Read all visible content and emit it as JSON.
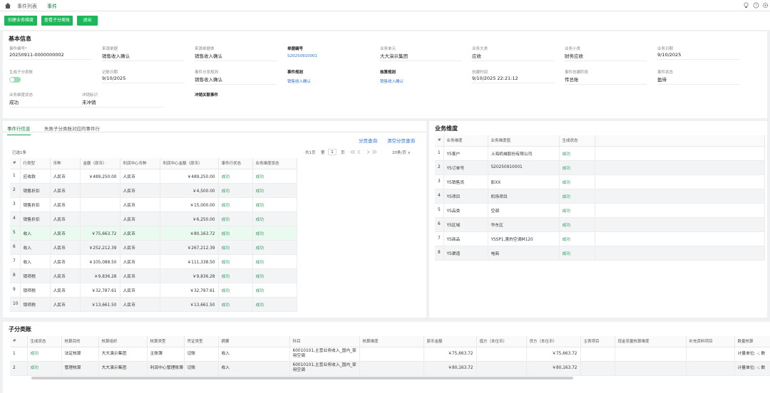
{
  "nav": {
    "tabs": [
      "事件列表",
      "事件"
    ],
    "active": 1
  },
  "toolbar": {
    "buttons": [
      "创建业务维度",
      "查看子分类账",
      "退出"
    ]
  },
  "basic": {
    "title": "基本信息",
    "fields": [
      {
        "label": "事件编号*",
        "value": "20250911-0000000002"
      },
      {
        "label": "来源单据",
        "value": "销售收入确认"
      },
      {
        "label": "来源单据体",
        "value": "销售收入确认"
      },
      {
        "label": "单据编号",
        "value": "S20250910001"
      },
      {
        "label": "业务单元",
        "value": "大大演示集团"
      },
      {
        "label": "业务大类",
        "value": "应收"
      },
      {
        "label": "业务小类",
        "value": "财务应收"
      },
      {
        "label": "业务日期",
        "value": "9/10/2025"
      },
      {
        "label": "生成子分类账",
        "value": ""
      },
      {
        "label": "记账日期",
        "value": "9/10/2025"
      },
      {
        "label": "事件分发规则",
        "value": "销售收入确认"
      },
      {
        "label": "事件规则",
        "value": "销售收入确认"
      },
      {
        "label": "核算规则",
        "value": "销售收入确认"
      },
      {
        "label": "创建时间",
        "value": "9/10/2025 22:21:12"
      },
      {
        "label": "事件创建阶段",
        "value": "传总账"
      },
      {
        "label": "事件状态",
        "value": "盈待"
      },
      {
        "label": "业务维度状态",
        "value": "成功"
      },
      {
        "label": "冲销标识",
        "value": "未冲销"
      },
      {
        "label": "冲销关联事件",
        "value": ""
      }
    ]
  },
  "lines": {
    "tabs": [
      "事件行信息",
      "失败子分类账对应的事件行"
    ],
    "actions": [
      "分页查询",
      "清空分页查询"
    ],
    "selected": "已选1条",
    "pager": {
      "total": "共1页",
      "page_prefix": "第",
      "page": "1",
      "page_suffix": "页",
      "size": "20条/页 ∨"
    },
    "headers": [
      "#",
      "行类型",
      "币种",
      "金额（原币）",
      "利润中心币种",
      "利润中心金额（原币）",
      "事件行状态",
      "业务维度状态"
    ],
    "rows": [
      [
        "1",
        "应收款",
        "人民币",
        "￥489,250.00",
        "人民币",
        "￥489,250.00",
        "成功",
        "成功"
      ],
      [
        "2",
        "销售折扣",
        "人民币",
        "",
        "人民币",
        "￥4,500.00",
        "成功",
        "成功"
      ],
      [
        "3",
        "销售折扣",
        "人民币",
        "",
        "人民币",
        "￥15,000.00",
        "成功",
        "成功"
      ],
      [
        "4",
        "销售折扣",
        "人民币",
        "",
        "人民币",
        "￥6,250.00",
        "成功",
        "成功"
      ],
      [
        "5",
        "收入",
        "人民币",
        "￥75,663.72",
        "人民币",
        "￥80,163.72",
        "成功",
        "成功"
      ],
      [
        "6",
        "收入",
        "人民币",
        "￥252,212.39",
        "人民币",
        "￥267,212.39",
        "成功",
        "成功"
      ],
      [
        "7",
        "收入",
        "人民币",
        "￥105,088.50",
        "人民币",
        "￥111,338.50",
        "成功",
        "成功"
      ],
      [
        "8",
        "销项税",
        "人民币",
        "￥9,836.28",
        "人民币",
        "￥9,836.28",
        "成功",
        "成功"
      ],
      [
        "9",
        "销项税",
        "人民币",
        "￥32,787.61",
        "人民币",
        "￥32,787.61",
        "成功",
        "成功"
      ],
      [
        "10",
        "销项税",
        "人民币",
        "￥13,661.50",
        "人民币",
        "￥13,661.50",
        "成功",
        "成功"
      ]
    ]
  },
  "dims": {
    "title": "业务维度",
    "headers": [
      "#",
      "业务维度",
      "业务维度值",
      "生成状态"
    ],
    "rows": [
      [
        "1",
        "YS客户",
        "上海机械股份有限公司",
        "成功"
      ],
      [
        "2",
        "YS订单号",
        "S20250910001",
        "成功"
      ],
      [
        "3",
        "YS销售员",
        "彭XX",
        "成功"
      ],
      [
        "4",
        "YS项目",
        "机场项目",
        "成功"
      ],
      [
        "5",
        "YS品类",
        "空调",
        "成功"
      ],
      [
        "6",
        "YS区域",
        "华东区",
        "成功"
      ],
      [
        "7",
        "YS商品",
        "YSSP1,美的空调M120",
        "成功"
      ],
      [
        "8",
        "YS渠道",
        "电商",
        "成功"
      ]
    ]
  },
  "ledger": {
    "title": "子分类账",
    "headers": [
      "#",
      "生成状态",
      "核算目的",
      "核算组织",
      "核算类型",
      "凭证类型",
      "摘要",
      "科目",
      "核算维度",
      "原币金额",
      "借方（本位币）",
      "贷方（本位币）",
      "主表项目",
      "现金流量核算维度",
      "补充资料项目",
      "数量核算"
    ],
    "rows": [
      [
        "1",
        "成功",
        "法定核算",
        "大大演示集团",
        "主账簿",
        "记账",
        "收入",
        "60010101,主营业务收入_国内_家用空调",
        "",
        "￥75,663.72",
        "",
        "￥75,663.72",
        "",
        "",
        "",
        "计量单位: -; 数"
      ],
      [
        "2",
        "成功",
        "管理核算",
        "大大演示集团",
        "利润中心管理账簿",
        "记账",
        "收入",
        "60010101,主营业务收入_国内_家用空调",
        "",
        "￥80,163.72",
        "",
        "￥80,163.72",
        "",
        "",
        "",
        "计量单位: -; 数"
      ]
    ]
  },
  "colors": {
    "accent": "#1fb55a",
    "link": "#2a6fd6",
    "success": "#1fa85a"
  }
}
